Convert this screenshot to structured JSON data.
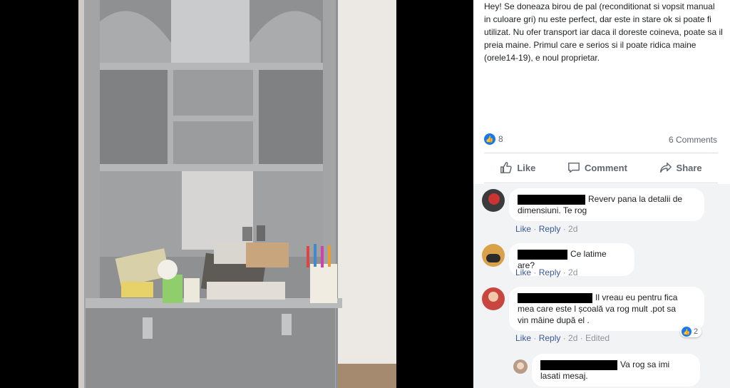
{
  "post": {
    "text": "Hey! Se doneaza birou de pal (reconditionat si vopsit manual in culoare gri) nu este perfect, dar este in stare ok si poate fi utilizat. Nu ofer transport iar daca il doreste coineva, poate sa il preia maine. Primul care e serios si il poate ridica maine (orele14-19), e noul proprietar.",
    "like_count": "8",
    "comment_count": "6 Comments"
  },
  "actions": {
    "like": "Like",
    "comment": "Comment",
    "share": "Share"
  },
  "comments": [
    {
      "text_line1": "Reverv pana la detalii de",
      "text_line2": "dimensiuni. Te rog",
      "like": "Like",
      "reply": "Reply",
      "time": "2d"
    },
    {
      "text_line1": "Ce latime are?",
      "like": "Like",
      "reply": "Reply",
      "time": "2d"
    },
    {
      "text_line1": "Il vreau eu pentru fica",
      "text_line2": "mea care este l școală va rog mult .pot sa",
      "text_line3": "vin mâine după el .",
      "like": "Like",
      "reply": "Reply",
      "time": "2d",
      "edited": "Edited",
      "reactions": "2"
    },
    {
      "text_line1": "Va rog sa imi",
      "text_line2": "lasati mesaj."
    }
  ],
  "colors": {
    "brand_blue": "#1877f2",
    "link_blue": "#385898",
    "muted": "#606770",
    "comment_bg": "#f2f3f5"
  },
  "icons": {
    "like": "thumbs-up-icon",
    "comment": "speech-bubble-icon",
    "share": "share-arrow-icon"
  }
}
